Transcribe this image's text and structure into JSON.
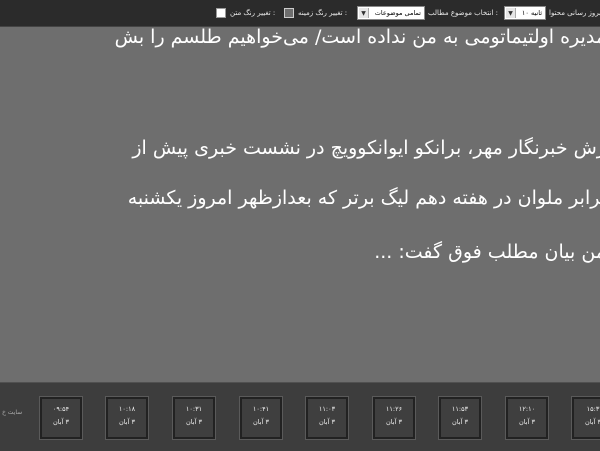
{
  "toolbar": {
    "text_color_label": "تغییر رنگ متن :",
    "bg_color_label": "تغییر رنگ زمینه :",
    "topic_label": "انتخاب موضوع مطالب :",
    "topic_value": "تمامی موضوعات",
    "refresh_label": "زمان بروز رسانی محتوا :",
    "refresh_value": "۱۰ ثانیه"
  },
  "news": {
    "title": "مدیره اولتیماتومی به من نداده است/ می‌خواهیم طلسم را بش",
    "lines": [
      "رش خبرنگار مهر، برانکو ایوانکوویچ در نشست خبری پیش از",
      "برابر ملوان در هفته دهم لیگ برتر که بعدازظهر امروز یکشنبه",
      "من بیان مطلب فوق گفت: ..."
    ]
  },
  "footer": {
    "site_label": "سایت خ",
    "cards": [
      {
        "time": "۰۹:۵۴",
        "date": "۳ آبان"
      },
      {
        "time": "۱۰:۱۸",
        "date": "۳ آبان"
      },
      {
        "time": "۱۰:۳۱",
        "date": "۳ آبان"
      },
      {
        "time": "۱۰:۴۱",
        "date": "۳ آبان"
      },
      {
        "time": "۱۱:۰۳",
        "date": "۳ آبان"
      },
      {
        "time": "۱۱:۲۶",
        "date": "۳ آبان"
      },
      {
        "time": "۱۱:۵۳",
        "date": "۳ آبان"
      },
      {
        "time": "۱۲:۱۰",
        "date": "۳ آبان"
      },
      {
        "time": "۱۵:۳",
        "date": "۳ آبان"
      }
    ]
  },
  "colors": {
    "background": "#6e6e6e",
    "toolbar": "#2b2b2b",
    "footer": "#3d3d3d",
    "text": "#ffffff"
  }
}
